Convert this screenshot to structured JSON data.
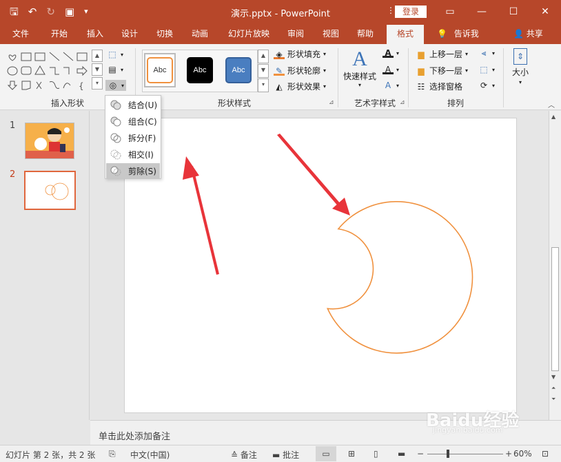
{
  "window": {
    "title": "演示.pptx  -  PowerPoint",
    "login_label": "登录",
    "ribbon_options_icon": "ribbon-display-icon",
    "minimize": "—",
    "maximize": "☐",
    "close": "✕"
  },
  "qat": {
    "save": "🖫",
    "undo": "↶",
    "redo": "↻",
    "present": "▣",
    "customize": "▾"
  },
  "tabs": [
    {
      "label": "文件"
    },
    {
      "label": "开始"
    },
    {
      "label": "插入"
    },
    {
      "label": "设计"
    },
    {
      "label": "切换"
    },
    {
      "label": "动画"
    },
    {
      "label": "幻灯片放映"
    },
    {
      "label": "审阅"
    },
    {
      "label": "视图"
    },
    {
      "label": "帮助"
    },
    {
      "label": "格式"
    }
  ],
  "tell_me": "告诉我",
  "share": "共享",
  "ribbon": {
    "insert_shapes_label": "插入形状",
    "shape_styles_label": "形状样式",
    "wordart_label": "艺术字样式",
    "arrange_label": "排列",
    "style_thumb_text": "Abc",
    "fill": "形状填充",
    "outline": "形状轮廓",
    "effects": "形状效果",
    "quick_styles": "快速样式",
    "bring_forward": "上移一层",
    "send_backward": "下移一层",
    "selection_pane": "选择窗格",
    "size": "大小"
  },
  "merge_menu": {
    "items": [
      {
        "label": "结合(U)"
      },
      {
        "label": "组合(C)"
      },
      {
        "label": "拆分(F)"
      },
      {
        "label": "相交(I)"
      },
      {
        "label": "剪除(S)"
      }
    ]
  },
  "slides": {
    "thumb1_number": "1",
    "thumb2_number": "2"
  },
  "notes_placeholder": "单击此处添加备注",
  "status": {
    "slide_info": "幻灯片 第 2 张，共 2 张",
    "language": "中文(中国)",
    "notes": "备注",
    "comments": "批注",
    "zoom": "60%"
  },
  "watermark": {
    "main": "Baidu经验",
    "sub": "jingyan.baidu.com"
  },
  "colors": {
    "accent": "#b7472a",
    "shape_outline": "#f0913e",
    "arrow": "#e8343a"
  }
}
